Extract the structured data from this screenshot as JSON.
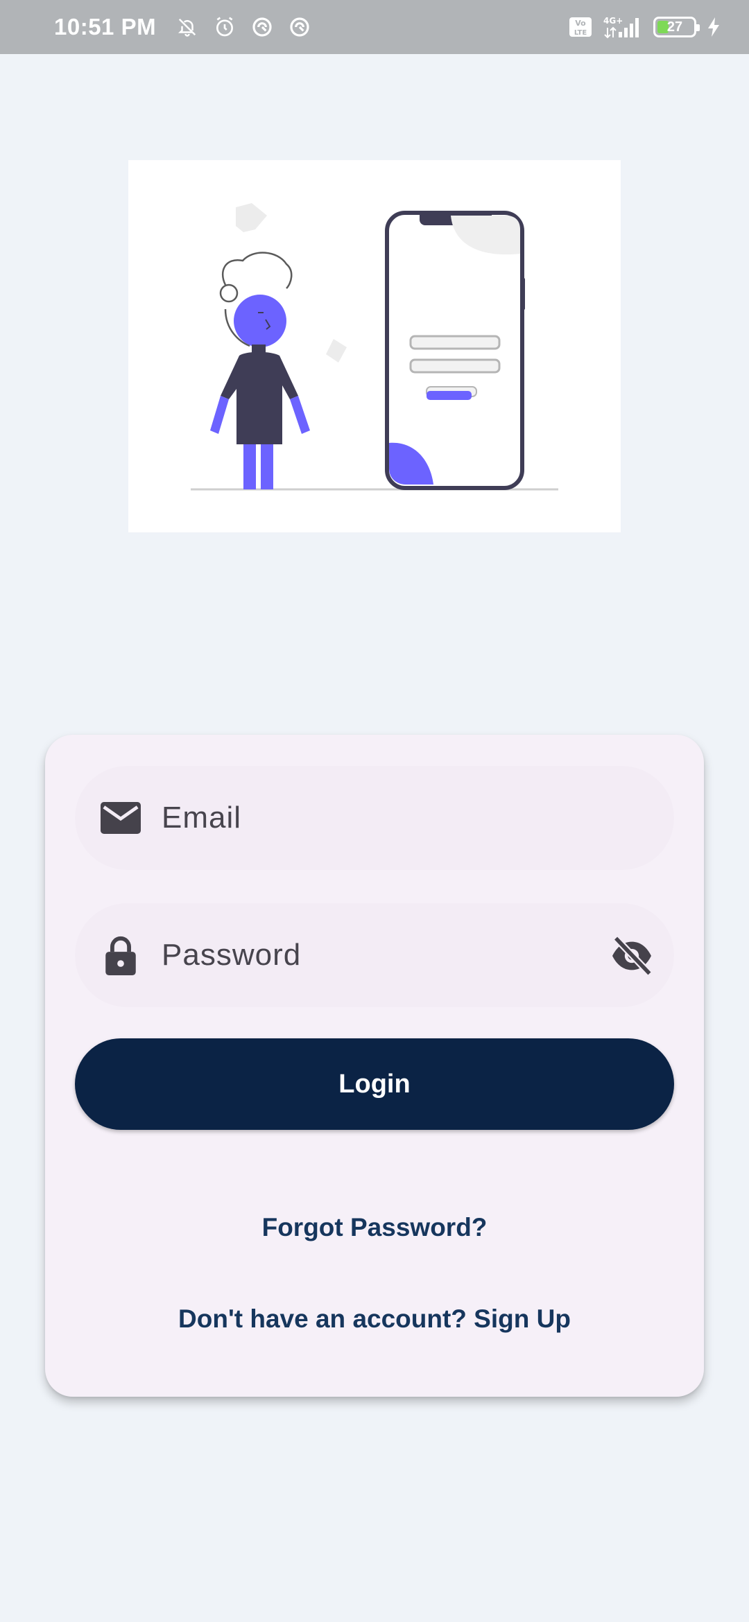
{
  "status_bar": {
    "time": "10:51 PM",
    "battery_level": "27",
    "network": "4G+",
    "volte": "Vo LTE",
    "icons": [
      "bell-off-icon",
      "alarm-icon",
      "data-saver-icon",
      "data-saver-icon",
      "volte-icon",
      "signal-icon",
      "battery-icon",
      "charging-icon"
    ]
  },
  "colors": {
    "background": "#eff3f8",
    "card": "#f6f0f8",
    "field": "#f3ecf5",
    "primary_button": "#0b2345",
    "link_text": "#16365d",
    "accent": "#6c63ff"
  },
  "form": {
    "email_placeholder": "Email",
    "password_placeholder": "Password",
    "email_icon": "mail-icon",
    "password_icon": "lock-icon",
    "visibility_icon": "eye-off-icon",
    "login_label": "Login",
    "forgot_label": "Forgot Password?",
    "signup_label": "Don't have an account? Sign Up"
  }
}
